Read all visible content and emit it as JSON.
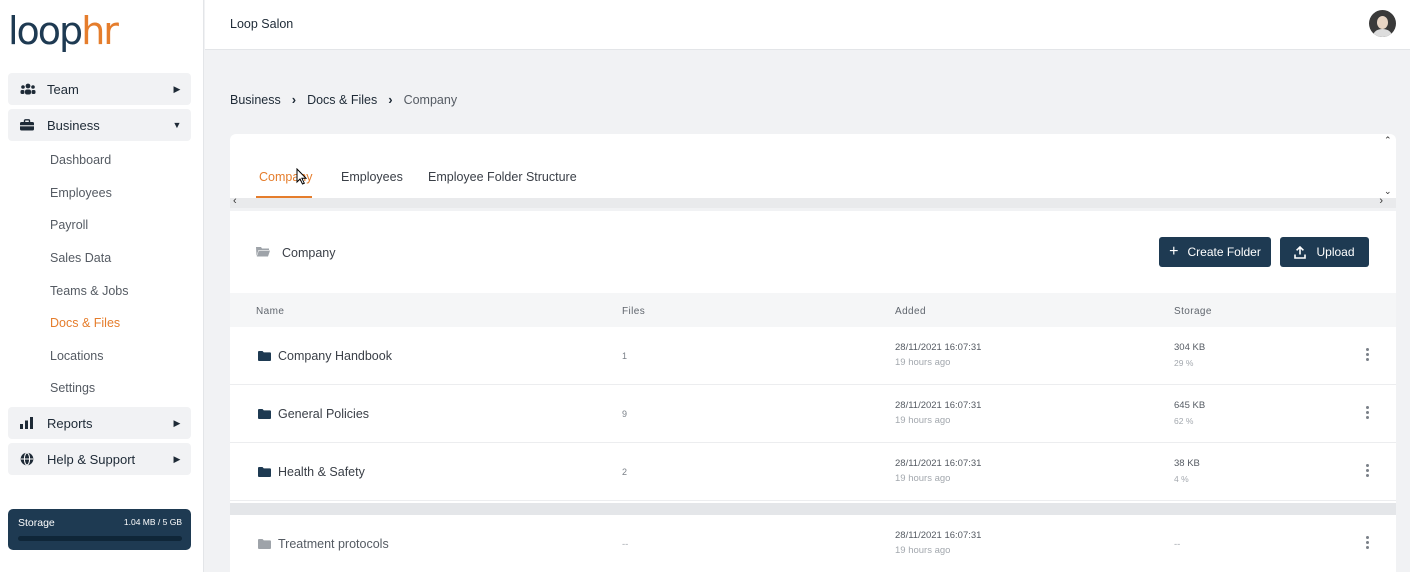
{
  "app": {
    "logo_part1": "loop",
    "logo_part2": "hr",
    "org_name": "Loop Salon"
  },
  "colors": {
    "primary": "#1e3a52",
    "accent": "#e57d2c",
    "background": "#f1f2f4"
  },
  "sidebar": {
    "team": {
      "label": "Team",
      "icon": "team-icon",
      "arrow": "▶"
    },
    "business": {
      "label": "Business",
      "icon": "briefcase-icon",
      "arrow": "▼"
    },
    "business_children": [
      {
        "label": "Dashboard"
      },
      {
        "label": "Employees"
      },
      {
        "label": "Payroll"
      },
      {
        "label": "Sales Data"
      },
      {
        "label": "Teams & Jobs"
      },
      {
        "label": "Docs & Files",
        "active": true
      },
      {
        "label": "Locations"
      },
      {
        "label": "Settings"
      }
    ],
    "reports": {
      "label": "Reports",
      "icon": "bar-chart-icon",
      "arrow": "▶"
    },
    "help": {
      "label": "Help & Support",
      "icon": "globe-icon",
      "arrow": "▶"
    },
    "storage": {
      "label": "Storage",
      "usage": "1.04 MB / 5 GB",
      "fraction": 0.0002
    }
  },
  "breadcrumb": {
    "items": [
      "Business",
      "Docs & Files"
    ],
    "current": "Company",
    "separator": "›"
  },
  "tabs": [
    {
      "label": "Company",
      "active": true
    },
    {
      "label": "Employees"
    },
    {
      "label": "Employee Folder Structure"
    }
  ],
  "folder": {
    "current": "Company",
    "create_folder_label": "Create Folder",
    "upload_label": "Upload"
  },
  "table": {
    "headers": {
      "name": "Name",
      "files": "Files",
      "added": "Added",
      "storage": "Storage"
    },
    "rows": [
      {
        "name": "Company Handbook",
        "files": "1",
        "date": "28/11/2021 16:07:31",
        "ago": "19 hours ago",
        "size": "304 KB",
        "pct": "29 %"
      },
      {
        "name": "General Policies",
        "files": "9",
        "date": "28/11/2021 16:07:31",
        "ago": "19 hours ago",
        "size": "645 KB",
        "pct": "62 %"
      },
      {
        "name": "Health & Safety",
        "files": "2",
        "date": "28/11/2021 16:07:31",
        "ago": "19 hours ago",
        "size": "38 KB",
        "pct": "4 %"
      }
    ],
    "extra_row": {
      "name": "Treatment protocols",
      "files": "--",
      "date": "28/11/2021 16:07:31",
      "ago": "19 hours ago",
      "size": "--"
    }
  }
}
